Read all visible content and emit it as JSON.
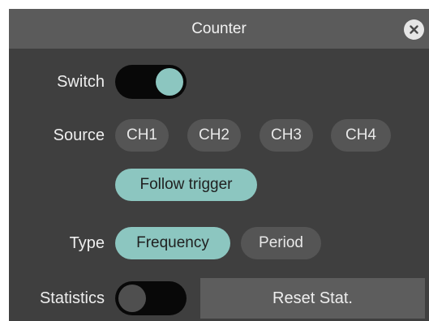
{
  "dialog": {
    "title": "Counter",
    "close_icon": "close-icon"
  },
  "switch": {
    "label": "Switch",
    "state": "on"
  },
  "source": {
    "label": "Source",
    "options": [
      "CH1",
      "CH2",
      "CH3",
      "CH4",
      "Follow trigger"
    ],
    "selected": "Follow trigger"
  },
  "type": {
    "label": "Type",
    "options": [
      "Frequency",
      "Period"
    ],
    "selected": "Frequency"
  },
  "statistics": {
    "label": "Statistics",
    "state": "off",
    "reset_label": "Reset Stat."
  },
  "colors": {
    "panel": "#3f3f3f",
    "titlebar": "#5b5b5b",
    "button": "#555555",
    "accent": "#8cc6c0"
  }
}
